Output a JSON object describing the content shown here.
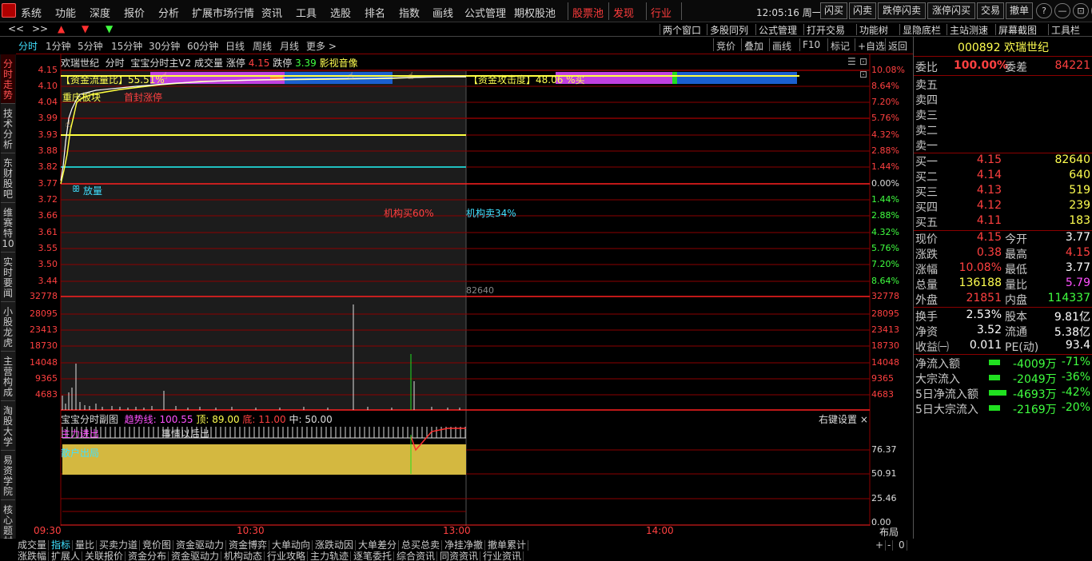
{
  "menubar": {
    "items": [
      "系统",
      "功能",
      "深度",
      "报价",
      "分析",
      "扩展市场行情",
      "资讯",
      "工具",
      "选股",
      "排名",
      "指数",
      "画线",
      "公式管理",
      "期权股池"
    ],
    "red_items": [
      "股票池",
      "发现",
      "行业"
    ],
    "clock": "12:05:16 周一",
    "buttons": [
      "闪买",
      "闪卖",
      "跌停闪卖",
      "涨停闪买",
      "交易",
      "撤单"
    ],
    "win_buttons": [
      "?",
      "—",
      "⊡",
      "✕"
    ]
  },
  "toolbar2": {
    "nav": [
      "<<",
      ">>",
      "▲",
      "▼",
      "▼"
    ],
    "right_items": [
      "两个窗口",
      "多股同列",
      "公式管理",
      "打开交易",
      "功能树",
      "显隐底栏",
      "主站测速",
      "屏幕截图",
      "工具栏"
    ]
  },
  "periods": [
    "分时",
    "1分钟",
    "5分钟",
    "15分钟",
    "30分钟",
    "60分钟",
    "日线",
    "周线",
    "月线",
    "更多 >"
  ],
  "period_active": "分时",
  "right_tools": [
    "竞价",
    "叠加",
    "画线",
    "F10",
    "标记",
    "+自选",
    "返回"
  ],
  "sidebar_tabs": [
    "分时走势",
    "技术分析",
    "东财股吧",
    "维赛特10",
    "实时要闻",
    "小股龙虎",
    "主营构成",
    "淘股大学",
    "易资学院",
    "核心题材"
  ],
  "chart": {
    "header": {
      "name": "欢瑞世纪",
      "mode": "分时",
      "indicator": "宝宝分时主V2",
      "vol_label": "成交量",
      "limit_up_label": "涨停",
      "limit_up": "4.15",
      "limit_down_label": "跌停",
      "limit_down": "3.39",
      "media": "影视音像"
    },
    "price_left": [
      "4.15",
      "4.10",
      "4.04",
      "3.99",
      "3.93",
      "3.88",
      "3.82",
      "3.77",
      "3.72",
      "3.66",
      "3.61",
      "3.55",
      "3.50",
      "3.44"
    ],
    "pct_right": [
      "10.08%",
      "8.64%",
      "7.20%",
      "5.76%",
      "4.32%",
      "2.88%",
      "1.44%",
      "0.00%",
      "1.44%",
      "2.88%",
      "4.32%",
      "5.76%",
      "7.20%",
      "8.64%"
    ],
    "vol_ticks": [
      "32778",
      "28095",
      "23413",
      "18730",
      "14048",
      "9365",
      "4683"
    ],
    "vol_last": "82640",
    "annotations": {
      "fund_flow": "【资金流量比】55.51%",
      "fund_attack": "【资金攻击度】48.06 %买",
      "sector": "重庆板块",
      "limit_hit": "首封涨停",
      "volume_tag": "放量",
      "inst_buy": "机构买60%",
      "inst_sell": "机构卖34%"
    },
    "sub": {
      "title": "宝宝分时副图",
      "trend_label": "趋势线:",
      "trend": "100.55",
      "top_label": "顶:",
      "top": "89.00",
      "bottom_label": "底:",
      "bottom": "11.00",
      "mid_label": "中:",
      "mid": "50.00",
      "settings": "右键设置 ×",
      "ticks": [
        "76.37",
        "50.91",
        "25.46",
        "0.00"
      ],
      "labels": [
        "主力进出",
        "散户出局",
        "事情以后出"
      ]
    },
    "time_ticks": [
      "09:30",
      "10:30",
      "13:00",
      "14:00"
    ],
    "layout_label": "布局"
  },
  "quote": {
    "code": "000892",
    "name": "欢瑞世纪",
    "weibi_label": "委比",
    "weibi": "100.00%",
    "weicha_label": "委差",
    "weicha": "84221",
    "sells": [
      "卖五",
      "卖四",
      "卖三",
      "卖二",
      "卖一"
    ],
    "buys": [
      {
        "label": "买一",
        "price": "4.15",
        "vol": "82640"
      },
      {
        "label": "买二",
        "price": "4.14",
        "vol": "640"
      },
      {
        "label": "买三",
        "price": "4.13",
        "vol": "519"
      },
      {
        "label": "买四",
        "price": "4.12",
        "vol": "239"
      },
      {
        "label": "买五",
        "price": "4.11",
        "vol": "183"
      }
    ],
    "stats": [
      {
        "k1": "现价",
        "v1": "4.15",
        "c1": "#ff4040",
        "k2": "今开",
        "v2": "3.77",
        "c2": "#ffffff"
      },
      {
        "k1": "涨跌",
        "v1": "0.38",
        "c1": "#ff4040",
        "k2": "最高",
        "v2": "4.15",
        "c2": "#ff4040"
      },
      {
        "k1": "涨幅",
        "v1": "10.08%",
        "c1": "#ff4040",
        "k2": "最低",
        "v2": "3.77",
        "c2": "#ffffff"
      },
      {
        "k1": "总量",
        "v1": "136188",
        "c1": "#ffff50",
        "k2": "量比",
        "v2": "5.79",
        "c2": "#ff50ff"
      },
      {
        "k1": "外盘",
        "v1": "21851",
        "c1": "#ff4040",
        "k2": "内盘",
        "v2": "114337",
        "c2": "#40ff40"
      }
    ],
    "stats2": [
      {
        "k1": "换手",
        "v1": "2.53%",
        "k2": "股本",
        "v2": "9.81亿"
      },
      {
        "k1": "净资",
        "v1": "3.52",
        "k2": "流通",
        "v2": "5.38亿"
      },
      {
        "k1": "收益㈠",
        "v1": "0.011",
        "k2": "PE(动)",
        "v2": "93.4"
      }
    ],
    "flows": [
      {
        "label": "净流入额",
        "val": "-4009万",
        "pct": "-71%"
      },
      {
        "label": "大宗流入",
        "val": "-2049万",
        "pct": "-36%"
      },
      {
        "label": "5日净流入额",
        "val": "-4693万",
        "pct": "-42%"
      },
      {
        "label": "5日大宗流入",
        "val": "-2169万",
        "pct": "-20%"
      }
    ]
  },
  "bottom_tabs": [
    "成交量",
    "指标",
    "量比",
    "买卖力道",
    "竞价图",
    "资金驱动力",
    "资金博弈",
    "大单动向",
    "涨跌动因",
    "大单差分",
    "总买总卖",
    "净挂净撤",
    "撤单累计"
  ],
  "bottom_active": "指标",
  "bottom_tabs2": [
    "涨跌幅",
    "扩展人",
    "关联报价",
    "资金分布",
    "资金驱动力",
    "机构动态",
    "行业攻略",
    "主力轨迹",
    "逐笔委托",
    "综合资讯",
    "同资资讯",
    "行业资讯"
  ],
  "bottom_right": [
    "+",
    "-",
    "0"
  ]
}
